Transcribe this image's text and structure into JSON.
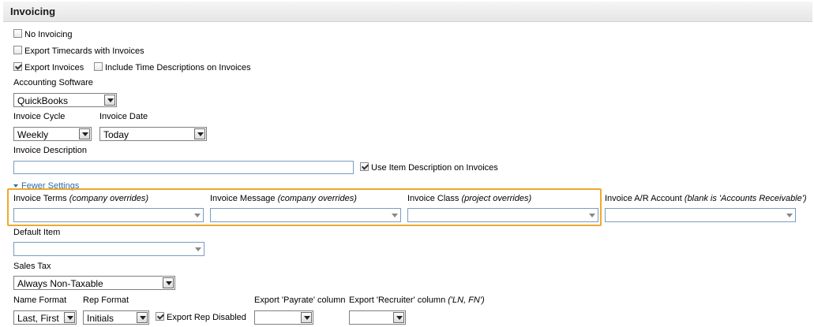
{
  "header": {
    "title": "Invoicing"
  },
  "checkboxes": {
    "no_invoicing": {
      "label": "No Invoicing",
      "checked": false
    },
    "export_timecards": {
      "label": "Export Timecards with Invoices",
      "checked": false
    },
    "export_invoices": {
      "label": "Export Invoices",
      "checked": true
    },
    "include_time_desc": {
      "label": "Include Time Descriptions on Invoices",
      "checked": false
    },
    "use_item_desc": {
      "label": "Use Item Description on Invoices",
      "checked": true
    },
    "export_rep_disabled": {
      "label": "Export Rep Disabled",
      "checked": true
    }
  },
  "accounting_software": {
    "label": "Accounting Software",
    "value": "QuickBooks"
  },
  "invoice_cycle": {
    "label": "Invoice Cycle",
    "value": "Weekly"
  },
  "invoice_date": {
    "label": "Invoice Date",
    "value": "Today"
  },
  "invoice_description": {
    "label": "Invoice Description",
    "value": ""
  },
  "fewer_settings": {
    "label": "Fewer Settings"
  },
  "invoice_terms": {
    "label": "Invoice Terms",
    "note": "(company overrides)",
    "value": ""
  },
  "invoice_message": {
    "label": "Invoice Message",
    "note": "(company overrides)",
    "value": ""
  },
  "invoice_class": {
    "label": "Invoice Class",
    "note": "(project overrides)",
    "value": ""
  },
  "invoice_ar_account": {
    "label": "Invoice A/R Account",
    "note": "(blank is 'Accounts Receivable')",
    "value": ""
  },
  "default_item": {
    "label": "Default Item",
    "value": ""
  },
  "sales_tax": {
    "label": "Sales Tax",
    "value": "Always Non-Taxable"
  },
  "name_format": {
    "label": "Name Format",
    "value": "Last, First"
  },
  "rep_format": {
    "label": "Rep Format",
    "value": "Initials"
  },
  "export_payrate_col": {
    "label": "Export 'Payrate' column",
    "value": ""
  },
  "export_recruiter_col": {
    "label": "Export 'Recruiter' column",
    "note": "('LN, FN')",
    "value": ""
  }
}
